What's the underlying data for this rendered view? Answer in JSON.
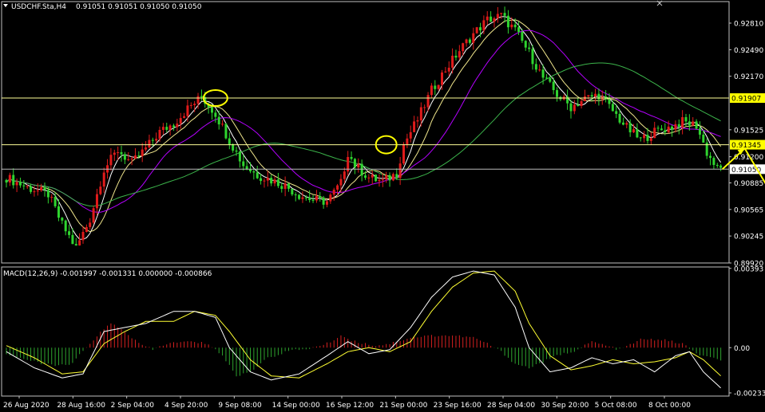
{
  "window": {
    "title": "USDCHF.Sta,H4",
    "ohlc": "0.91051 0.91051 0.91050 0.91050",
    "menu_icon": "triangle-down-icon",
    "close_icon": "close-icon"
  },
  "colors": {
    "background": "#000000",
    "frame": "#c0c0c0",
    "bull_candle": "#e11b1b",
    "bear_candle": "#2fd52f",
    "ma_fast": "#ffffff",
    "ma_mid": "#f0e68c",
    "ma_slow": "#b400ff",
    "ma_long": "#3cb44b",
    "level_line": "#ffff99",
    "level_label_bg": "#ffff00",
    "white_level_bg": "#ffffff",
    "macd_pos": "#d62020",
    "macd_neg": "#2ea32e",
    "macd_line": "#ffffff",
    "signal_line": "#ffff33",
    "circle": "#ffff00",
    "arrow": "#ffff00"
  },
  "chart_data": [
    {
      "type": "candlestick",
      "ylim": [
        0.8992,
        0.9305
      ],
      "y_ticks": [
        "0.92810",
        "0.92490",
        "0.92170",
        "0.91850",
        "0.91525",
        "0.91200",
        "0.90885",
        "0.90565",
        "0.90245",
        "0.89920"
      ],
      "y_tick_values": [
        0.9281,
        0.9249,
        0.9217,
        0.9185,
        0.91525,
        0.912,
        0.90885,
        0.90565,
        0.90245,
        0.8992
      ],
      "x_ticks": [
        "26 Aug 2020",
        "28 Aug 16:00",
        "2 Sep 04:00",
        "4 Sep 20:00",
        "9 Sep 08:00",
        "14 Sep 00:00",
        "16 Sep 12:00",
        "21 Sep 00:00",
        "23 Sep 16:00",
        "28 Sep 04:00",
        "30 Sep 20:00",
        "5 Oct 08:00",
        "8 Oct 00:00"
      ],
      "horizontal_levels": [
        {
          "value": 0.91907,
          "label": "0.91907",
          "style": "yellow"
        },
        {
          "value": 0.91345,
          "label": "0.91345",
          "style": "yellow"
        },
        {
          "value": 0.9105,
          "label": "0.91050",
          "style": "white"
        }
      ],
      "close_path": [
        [
          0,
          0.9095
        ],
        [
          6,
          0.9083
        ],
        [
          12,
          0.9075
        ],
        [
          16,
          0.9038
        ],
        [
          20,
          0.901
        ],
        [
          24,
          0.9045
        ],
        [
          28,
          0.9105
        ],
        [
          32,
          0.9128
        ],
        [
          36,
          0.9112
        ],
        [
          40,
          0.913
        ],
        [
          44,
          0.915
        ],
        [
          48,
          0.916
        ],
        [
          52,
          0.9178
        ],
        [
          56,
          0.9192
        ],
        [
          60,
          0.9172
        ],
        [
          64,
          0.914
        ],
        [
          68,
          0.911
        ],
        [
          72,
          0.9098
        ],
        [
          76,
          0.9092
        ],
        [
          80,
          0.9085
        ],
        [
          84,
          0.9074
        ],
        [
          88,
          0.9068
        ],
        [
          92,
          0.9066
        ],
        [
          96,
          0.9088
        ],
        [
          98,
          0.9125
        ],
        [
          100,
          0.911
        ],
        [
          104,
          0.9095
        ],
        [
          108,
          0.909
        ],
        [
          112,
          0.91
        ],
        [
          114,
          0.9135
        ],
        [
          118,
          0.9165
        ],
        [
          122,
          0.92
        ],
        [
          126,
          0.9225
        ],
        [
          130,
          0.9248
        ],
        [
          134,
          0.9268
        ],
        [
          138,
          0.9285
        ],
        [
          142,
          0.929
        ],
        [
          146,
          0.9272
        ],
        [
          150,
          0.9245
        ],
        [
          154,
          0.9215
        ],
        [
          158,
          0.9195
        ],
        [
          162,
          0.918
        ],
        [
          166,
          0.919
        ],
        [
          170,
          0.9195
        ],
        [
          174,
          0.9175
        ],
        [
          178,
          0.9155
        ],
        [
          182,
          0.914
        ],
        [
          186,
          0.915
        ],
        [
          190,
          0.9155
        ],
        [
          194,
          0.9162
        ],
        [
          198,
          0.9158
        ],
        [
          201,
          0.9125
        ],
        [
          204,
          0.9105
        ]
      ],
      "circles": [
        "4 Sep top",
        "16 Sep top"
      ],
      "projection_arrows": [
        {
          "from": 0.9105,
          "to": 0.913
        },
        {
          "from": 0.913,
          "to": 0.9062
        }
      ]
    },
    {
      "type": "macd",
      "title": "MACD(12,26,9) -0.001997 -0.001331 0.000000 -0.000866",
      "y_ticks": [
        "0.00393",
        "0.00",
        "-0.002331"
      ],
      "y_tick_values": [
        0.00393,
        0.0,
        -0.002331
      ],
      "ylim": [
        -0.0024,
        0.004
      ],
      "histogram_path": [
        [
          0,
          -0.0003
        ],
        [
          10,
          -0.0008
        ],
        [
          18,
          -0.0009
        ],
        [
          22,
          -0.0002
        ],
        [
          26,
          0.0006
        ],
        [
          30,
          0.0012
        ],
        [
          34,
          0.0008
        ],
        [
          38,
          0.0002
        ],
        [
          42,
          -0.0001
        ],
        [
          46,
          0.0002
        ],
        [
          52,
          0.0003
        ],
        [
          58,
          0.0002
        ],
        [
          62,
          -0.0004
        ],
        [
          66,
          -0.0014
        ],
        [
          70,
          -0.0012
        ],
        [
          74,
          -0.0006
        ],
        [
          80,
          -0.0002
        ],
        [
          88,
          0.0
        ],
        [
          92,
          0.0002
        ],
        [
          96,
          0.0006
        ],
        [
          100,
          0.0003
        ],
        [
          106,
          0.0001
        ],
        [
          110,
          0.0002
        ],
        [
          116,
          0.0005
        ],
        [
          122,
          0.0006
        ],
        [
          128,
          0.0006
        ],
        [
          134,
          0.0005
        ],
        [
          138,
          0.0002
        ],
        [
          142,
          -0.0002
        ],
        [
          146,
          -0.0008
        ],
        [
          150,
          -0.001
        ],
        [
          154,
          -0.0007
        ],
        [
          158,
          -0.0004
        ],
        [
          164,
          -0.0001
        ],
        [
          168,
          0.0003
        ],
        [
          172,
          0.0001
        ],
        [
          176,
          -0.0001
        ],
        [
          182,
          0.0004
        ],
        [
          188,
          0.0004
        ],
        [
          194,
          0.0002
        ],
        [
          198,
          -0.0003
        ],
        [
          204,
          -0.0006
        ]
      ],
      "macd_path": [
        [
          0,
          -0.0002
        ],
        [
          8,
          -0.001
        ],
        [
          16,
          -0.0015
        ],
        [
          22,
          -0.0013
        ],
        [
          28,
          0.0008
        ],
        [
          34,
          0.001
        ],
        [
          40,
          0.0012
        ],
        [
          48,
          0.0018
        ],
        [
          54,
          0.0018
        ],
        [
          60,
          0.0015
        ],
        [
          64,
          0.0
        ],
        [
          70,
          -0.0012
        ],
        [
          76,
          -0.0016
        ],
        [
          84,
          -0.0013
        ],
        [
          92,
          -0.0004
        ],
        [
          98,
          0.0003
        ],
        [
          104,
          -0.0003
        ],
        [
          110,
          -0.0001
        ],
        [
          116,
          0.001
        ],
        [
          122,
          0.0025
        ],
        [
          128,
          0.0035
        ],
        [
          134,
          0.0038
        ],
        [
          140,
          0.0036
        ],
        [
          146,
          0.002
        ],
        [
          150,
          0.0
        ],
        [
          156,
          -0.0012
        ],
        [
          162,
          -0.001
        ],
        [
          168,
          -0.0005
        ],
        [
          174,
          -0.0008
        ],
        [
          180,
          -0.0006
        ],
        [
          186,
          -0.0012
        ],
        [
          192,
          -0.0004
        ],
        [
          196,
          -0.0002
        ],
        [
          200,
          -0.0012
        ],
        [
          205,
          -0.002
        ]
      ],
      "signal_path": [
        [
          0,
          0.0001
        ],
        [
          8,
          -0.0005
        ],
        [
          16,
          -0.0013
        ],
        [
          22,
          -0.0012
        ],
        [
          28,
          0.0002
        ],
        [
          34,
          0.0008
        ],
        [
          40,
          0.0013
        ],
        [
          48,
          0.0013
        ],
        [
          54,
          0.0018
        ],
        [
          60,
          0.0016
        ],
        [
          64,
          0.0008
        ],
        [
          70,
          -0.0006
        ],
        [
          76,
          -0.0014
        ],
        [
          84,
          -0.0015
        ],
        [
          92,
          -0.0008
        ],
        [
          98,
          -0.0002
        ],
        [
          104,
          0.0
        ],
        [
          110,
          -0.0002
        ],
        [
          116,
          0.0003
        ],
        [
          122,
          0.0018
        ],
        [
          128,
          0.003
        ],
        [
          134,
          0.0037
        ],
        [
          140,
          0.0038
        ],
        [
          146,
          0.0028
        ],
        [
          150,
          0.0012
        ],
        [
          156,
          -0.0004
        ],
        [
          162,
          -0.0011
        ],
        [
          168,
          -0.0009
        ],
        [
          174,
          -0.0006
        ],
        [
          180,
          -0.0008
        ],
        [
          186,
          -0.0007
        ],
        [
          192,
          -0.0005
        ],
        [
          196,
          -0.0002
        ],
        [
          200,
          -0.0006
        ],
        [
          205,
          -0.0014
        ]
      ]
    }
  ]
}
